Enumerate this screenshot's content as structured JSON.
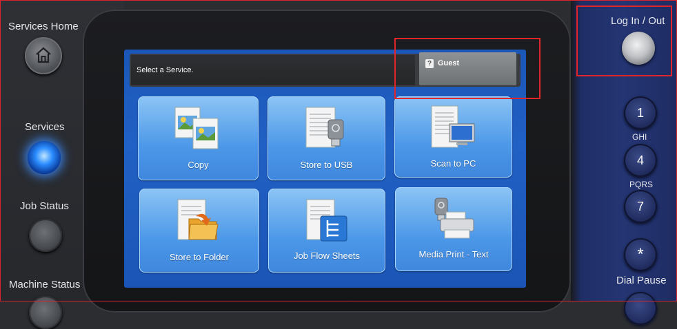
{
  "left_panel": {
    "services_home_label": "Services Home",
    "services_label": "Services",
    "job_status_label": "Job Status",
    "machine_status_label": "Machine Status"
  },
  "screen": {
    "prompt": "Select a Service.",
    "guest_label": "Guest",
    "tiles": [
      {
        "label": "Copy",
        "icon": "copy-icon"
      },
      {
        "label": "Store to USB",
        "icon": "store-to-usb-icon"
      },
      {
        "label": "Scan to PC",
        "icon": "scan-to-pc-icon"
      },
      {
        "label": "Store to Folder",
        "icon": "store-to-folder-icon"
      },
      {
        "label": "Job Flow Sheets",
        "icon": "job-flow-sheets-icon"
      },
      {
        "label": "Media Print - Text",
        "icon": "media-print-text-icon"
      }
    ]
  },
  "right_panel": {
    "login_label": "Log In / Out",
    "keys": [
      {
        "digit": "1",
        "sub": "GHI"
      },
      {
        "digit": "4",
        "sub": "PQRS"
      },
      {
        "digit": "7"
      },
      {
        "digit": "*"
      }
    ],
    "dial_pause_label": "Dial Pause"
  },
  "colors": {
    "highlight": "#e0252b",
    "screen_bg": "#1f5fc2",
    "tile": "#5aa3ec",
    "services_led": "#2a8cff",
    "right_panel": "#233471"
  }
}
